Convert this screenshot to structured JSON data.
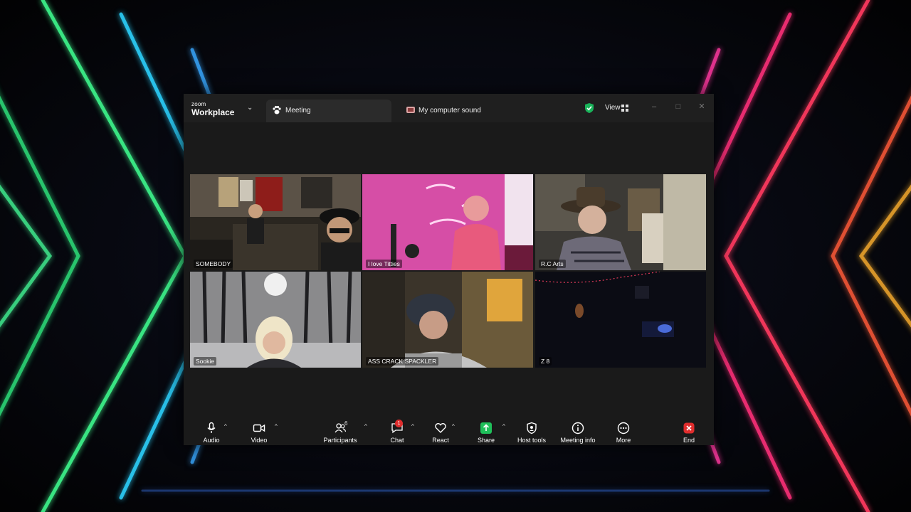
{
  "app": {
    "brand_small": "zoom",
    "brand_big": "Workplace"
  },
  "tabs": [
    {
      "label": "Meeting"
    },
    {
      "label": "My computer sound"
    }
  ],
  "view": {
    "label": "View"
  },
  "participants": [
    {
      "name": "SOMEBODY"
    },
    {
      "name": "I love Titties"
    },
    {
      "name": "R.C Arts"
    },
    {
      "name": "Sookie"
    },
    {
      "name": "ASS CRACK SPACKLER"
    },
    {
      "name": "Z 8",
      "active": true
    }
  ],
  "toolbar": {
    "audio": "Audio",
    "video": "Video",
    "participants": "Participants",
    "participants_count": "6",
    "chat": "Chat",
    "chat_badge": "1",
    "react": "React",
    "share": "Share",
    "host_tools": "Host tools",
    "meeting_info": "Meeting info",
    "more": "More",
    "end": "End"
  },
  "colors": {
    "active_speaker": "#21d07a",
    "share_green": "#1fbf5a",
    "end_red": "#e02d2d",
    "shield_green": "#19b35a"
  }
}
